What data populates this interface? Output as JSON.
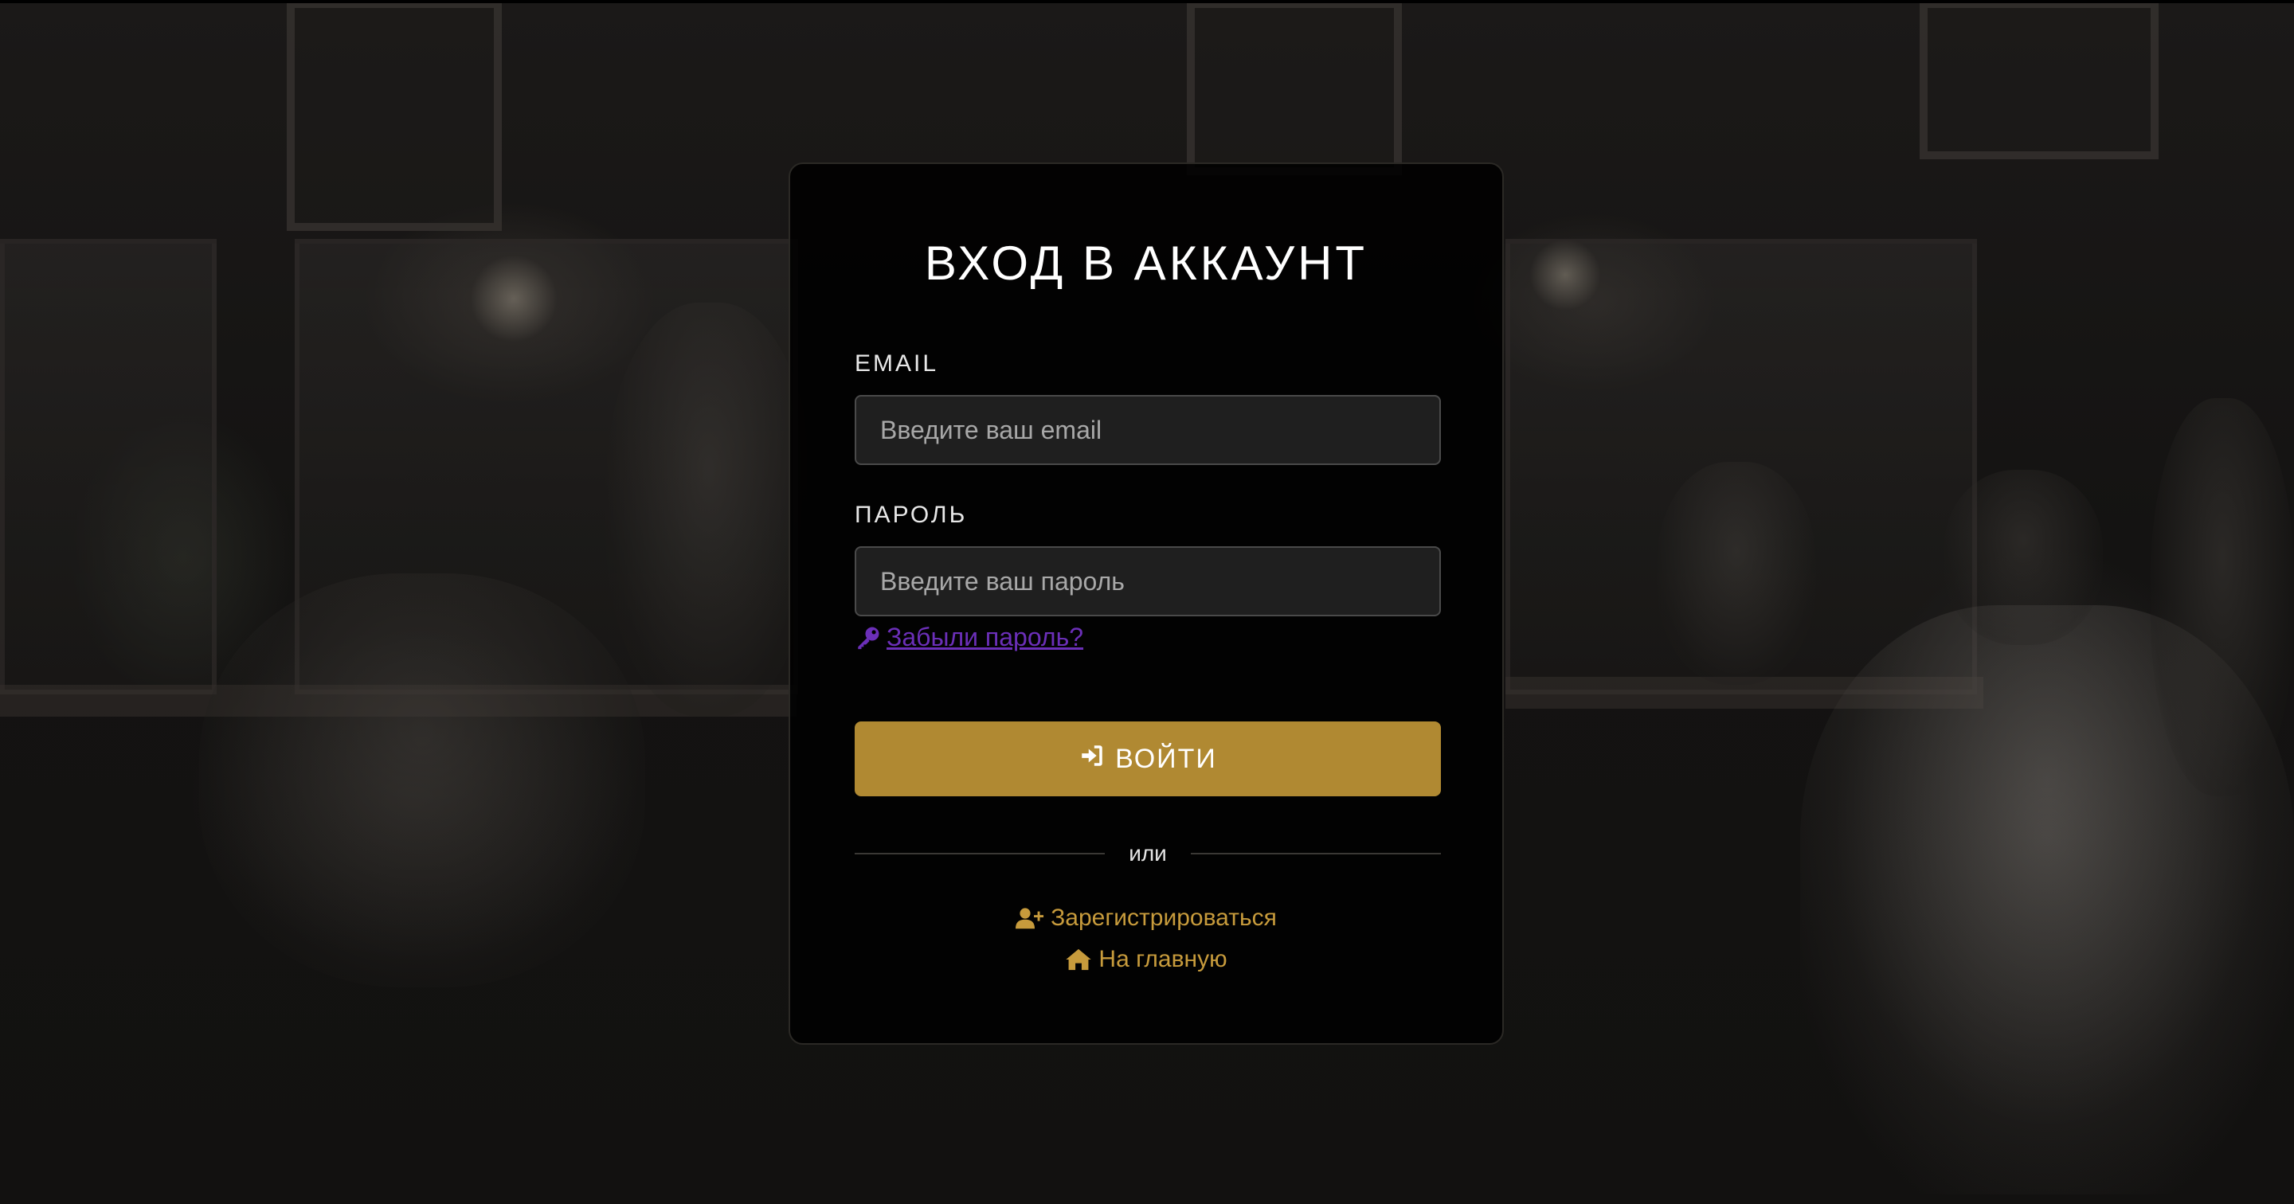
{
  "page": {
    "title": "ВХОД В АККАУНТ"
  },
  "form": {
    "email_label": "EMAIL",
    "email_placeholder": "Введите ваш email",
    "email_value": "",
    "password_label": "ПАРОЛЬ",
    "password_placeholder": "Введите ваш пароль",
    "password_value": "",
    "forgot_link": "Забыли пароль?",
    "submit_label": "ВОЙТИ"
  },
  "divider_text": "или",
  "links": {
    "register": "Зарегистрироваться",
    "home": "На главную"
  },
  "icons": {
    "forgot": "key-icon",
    "submit": "sign-in-icon",
    "register": "user-plus-icon",
    "home": "home-icon"
  },
  "colors": {
    "accent": "#b08932",
    "link_accent": "#c79b3c",
    "forgot_link": "#6b2fb8",
    "card_bg": "#000000"
  }
}
